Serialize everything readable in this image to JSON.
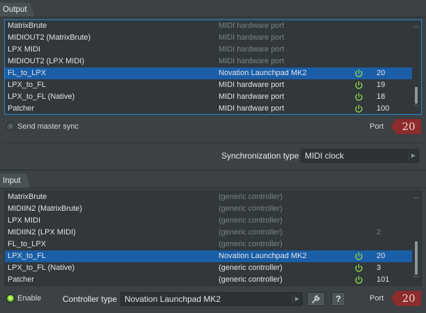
{
  "output": {
    "tab_label": "Output",
    "rows": [
      {
        "name": "MatrixBrute",
        "desc": "MIDI hardware port",
        "enabled": false,
        "port": ""
      },
      {
        "name": "MIDIOUT2 (MatrixBrute)",
        "desc": "MIDI hardware port",
        "enabled": false,
        "port": ""
      },
      {
        "name": "LPX MIDI",
        "desc": "MIDI hardware port",
        "enabled": false,
        "port": ""
      },
      {
        "name": "MIDIOUT2 (LPX MIDI)",
        "desc": "MIDI hardware port",
        "enabled": false,
        "port": ""
      },
      {
        "name": "FL_to_LPX",
        "desc": "Novation Launchpad MK2",
        "enabled": true,
        "port": "20",
        "selected": true
      },
      {
        "name": "LPX_to_FL",
        "desc": "MIDI hardware port",
        "enabled": true,
        "port": "19"
      },
      {
        "name": "LPX_to_FL (Native)",
        "desc": "MIDI hardware port",
        "enabled": true,
        "port": "18"
      },
      {
        "name": "Patcher",
        "desc": "MIDI hardware port",
        "enabled": true,
        "port": "100"
      }
    ],
    "send_master_sync_label": "Send master sync",
    "port_label": "Port",
    "port_value": "20",
    "sync_type_label": "Synchronization type",
    "sync_type_value": "MIDI clock"
  },
  "input": {
    "tab_label": "Input",
    "rows": [
      {
        "name": "MatrixBrute",
        "desc": "(generic controller)",
        "enabled": false,
        "port": ""
      },
      {
        "name": "MIDIIN2 (MatrixBrute)",
        "desc": "(generic controller)",
        "enabled": false,
        "port": ""
      },
      {
        "name": "LPX MIDI",
        "desc": "(generic controller)",
        "enabled": false,
        "port": ""
      },
      {
        "name": "MIDIIN2 (LPX MIDI)",
        "desc": "(generic controller)",
        "enabled": false,
        "port": "2"
      },
      {
        "name": "FL_to_LPX",
        "desc": "(generic controller)",
        "enabled": false,
        "port": ""
      },
      {
        "name": "LPX_to_FL",
        "desc": "Novation Launchpad MK2",
        "enabled": true,
        "port": "20",
        "selected": true
      },
      {
        "name": "LPX_to_FL (Native)",
        "desc": "(generic controller)",
        "enabled": true,
        "port": "3"
      },
      {
        "name": "Patcher",
        "desc": "(generic controller)",
        "enabled": true,
        "port": "101"
      }
    ],
    "enable_label": "Enable",
    "controller_type_label": "Controller type",
    "controller_type_value": "Novation Launchpad MK2",
    "port_label": "Port",
    "port_value": "20",
    "help_label": "?"
  },
  "icons": {
    "power": "power-icon",
    "wrench": "wrench-icon"
  },
  "colors": {
    "selection": "#1b5ea8",
    "power_on": "#8fd64a",
    "port_box": "#8c2c2c",
    "led_on": "#7cc13a"
  }
}
